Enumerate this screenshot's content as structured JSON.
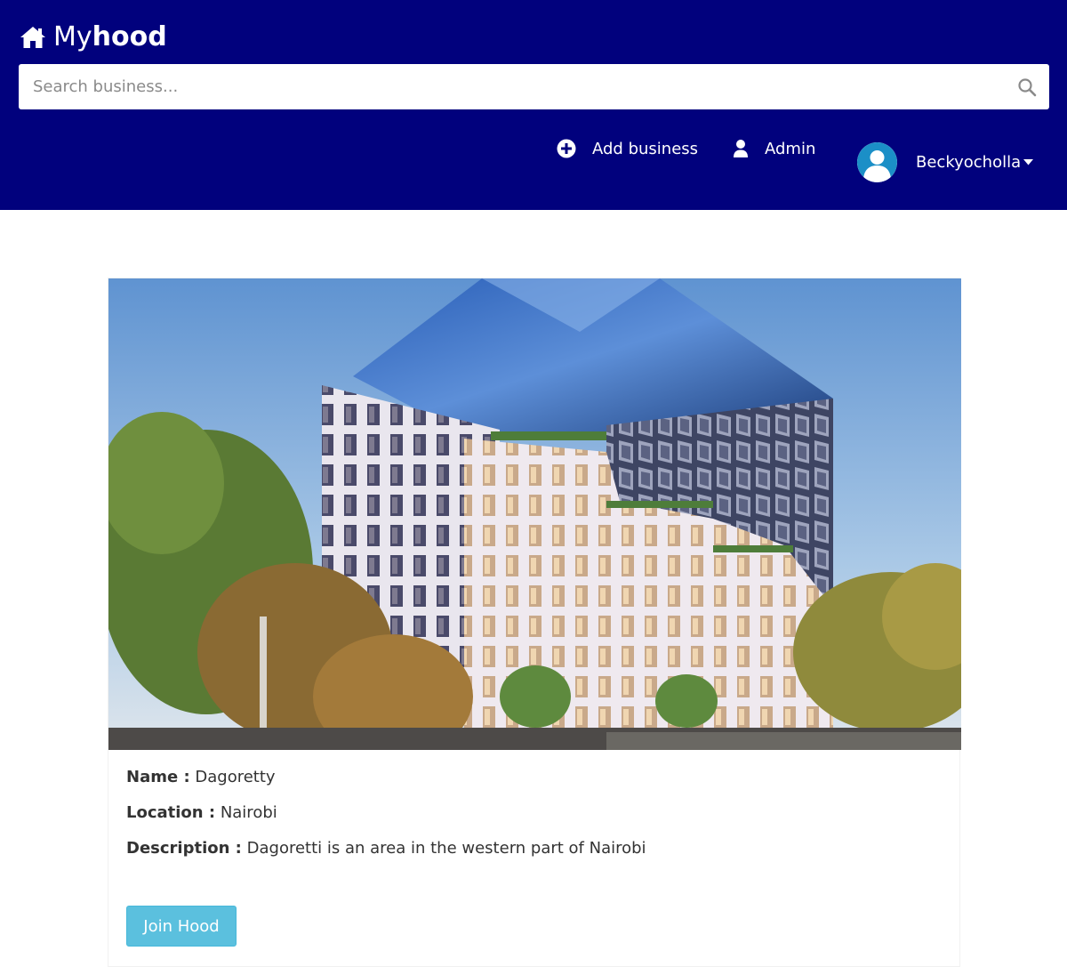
{
  "brand": {
    "icon": "home-icon",
    "name_part1": "My",
    "name_part2": "hood"
  },
  "search": {
    "placeholder": "Search business...",
    "value": "",
    "icon": "search-icon"
  },
  "nav": {
    "add_business": {
      "label": "Add business",
      "icon": "plus-circle-icon"
    },
    "admin": {
      "label": "Admin",
      "icon": "user-icon"
    },
    "user": {
      "name": "Beckyocholla",
      "icon": "avatar",
      "caret": "caret-down-icon"
    }
  },
  "hood": {
    "image": "building-photo",
    "name_label": "Name :",
    "name": "Dagoretty",
    "location_label": "Location :",
    "location": "Nairobi",
    "description_label": "Description :",
    "description": "Dagoretti is an area in the western part of Nairobi",
    "join_label": "Join Hood"
  },
  "colors": {
    "navbar": "#01017d",
    "button": "#5bc0de",
    "avatar_bg": "#1b8fc7"
  }
}
